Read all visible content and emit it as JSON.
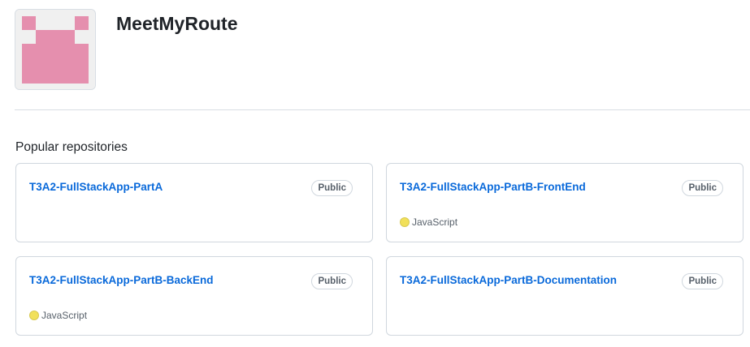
{
  "org": {
    "name": "MeetMyRoute",
    "avatar_icon": "identicon-avatar",
    "avatar_color": "#e58fae"
  },
  "section": {
    "title": "Popular repositories"
  },
  "repos": [
    {
      "name": "T3A2-FullStackApp-PartA",
      "visibility": "Public",
      "language": null,
      "language_color": null
    },
    {
      "name": "T3A2-FullStackApp-PartB-FrontEnd",
      "visibility": "Public",
      "language": "JavaScript",
      "language_color": "#f1e05a"
    },
    {
      "name": "T3A2-FullStackApp-PartB-BackEnd",
      "visibility": "Public",
      "language": "JavaScript",
      "language_color": "#f1e05a"
    },
    {
      "name": "T3A2-FullStackApp-PartB-Documentation",
      "visibility": "Public",
      "language": null,
      "language_color": null
    }
  ],
  "colors": {
    "link": "#0969da",
    "border": "#d0d7de",
    "muted": "#57606a"
  }
}
